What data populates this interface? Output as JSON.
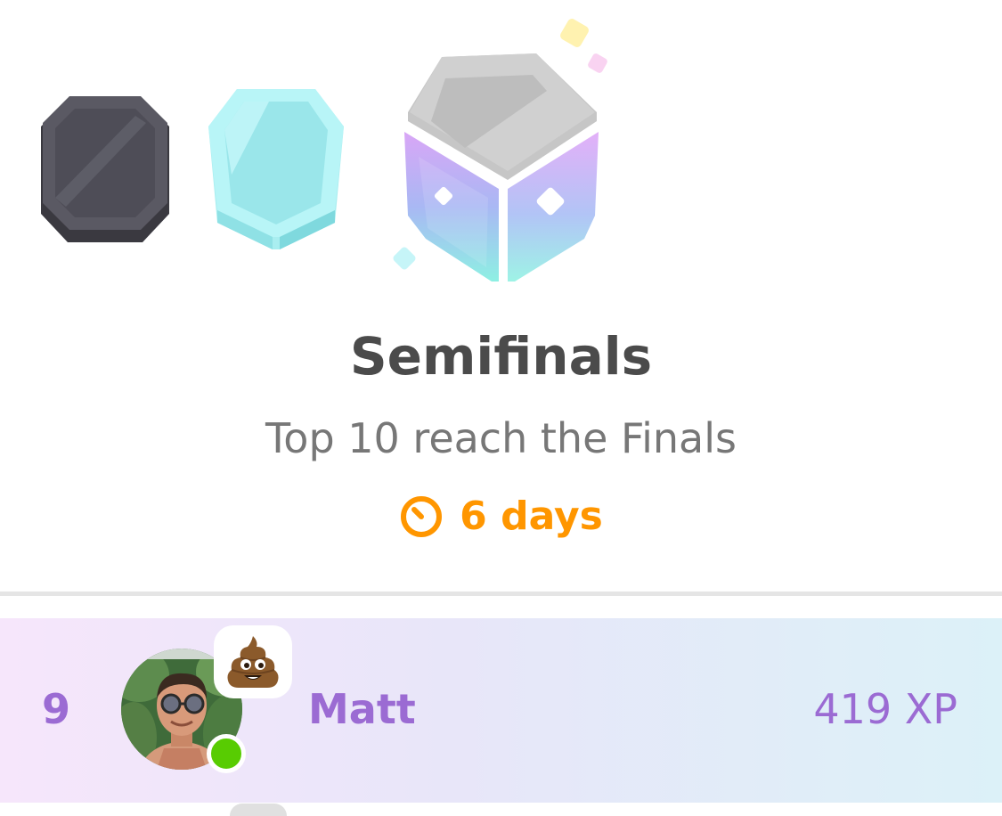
{
  "league": {
    "title": "Semifinals",
    "subtitle": "Top 10 reach the Finals",
    "time_remaining": "6 days",
    "badges": [
      {
        "name": "Obsidian",
        "state": "past",
        "color": "#4b4a55"
      },
      {
        "name": "Diamond",
        "state": "past",
        "color": "#8ee8ec"
      },
      {
        "name": "Semifinals",
        "state": "current",
        "color": "#c9c9c9"
      }
    ]
  },
  "leaderboard": {
    "rows": [
      {
        "rank": "9",
        "name": "Matt",
        "xp": "419 XP",
        "status_emoji": "poop-emoji",
        "online": true,
        "highlighted": true
      }
    ]
  },
  "colors": {
    "accent_purple": "#9b6bd3",
    "timer_orange": "#ff9600",
    "title_gray": "#4b4b4b",
    "subtitle_gray": "#777777",
    "online_green": "#58cc02"
  }
}
